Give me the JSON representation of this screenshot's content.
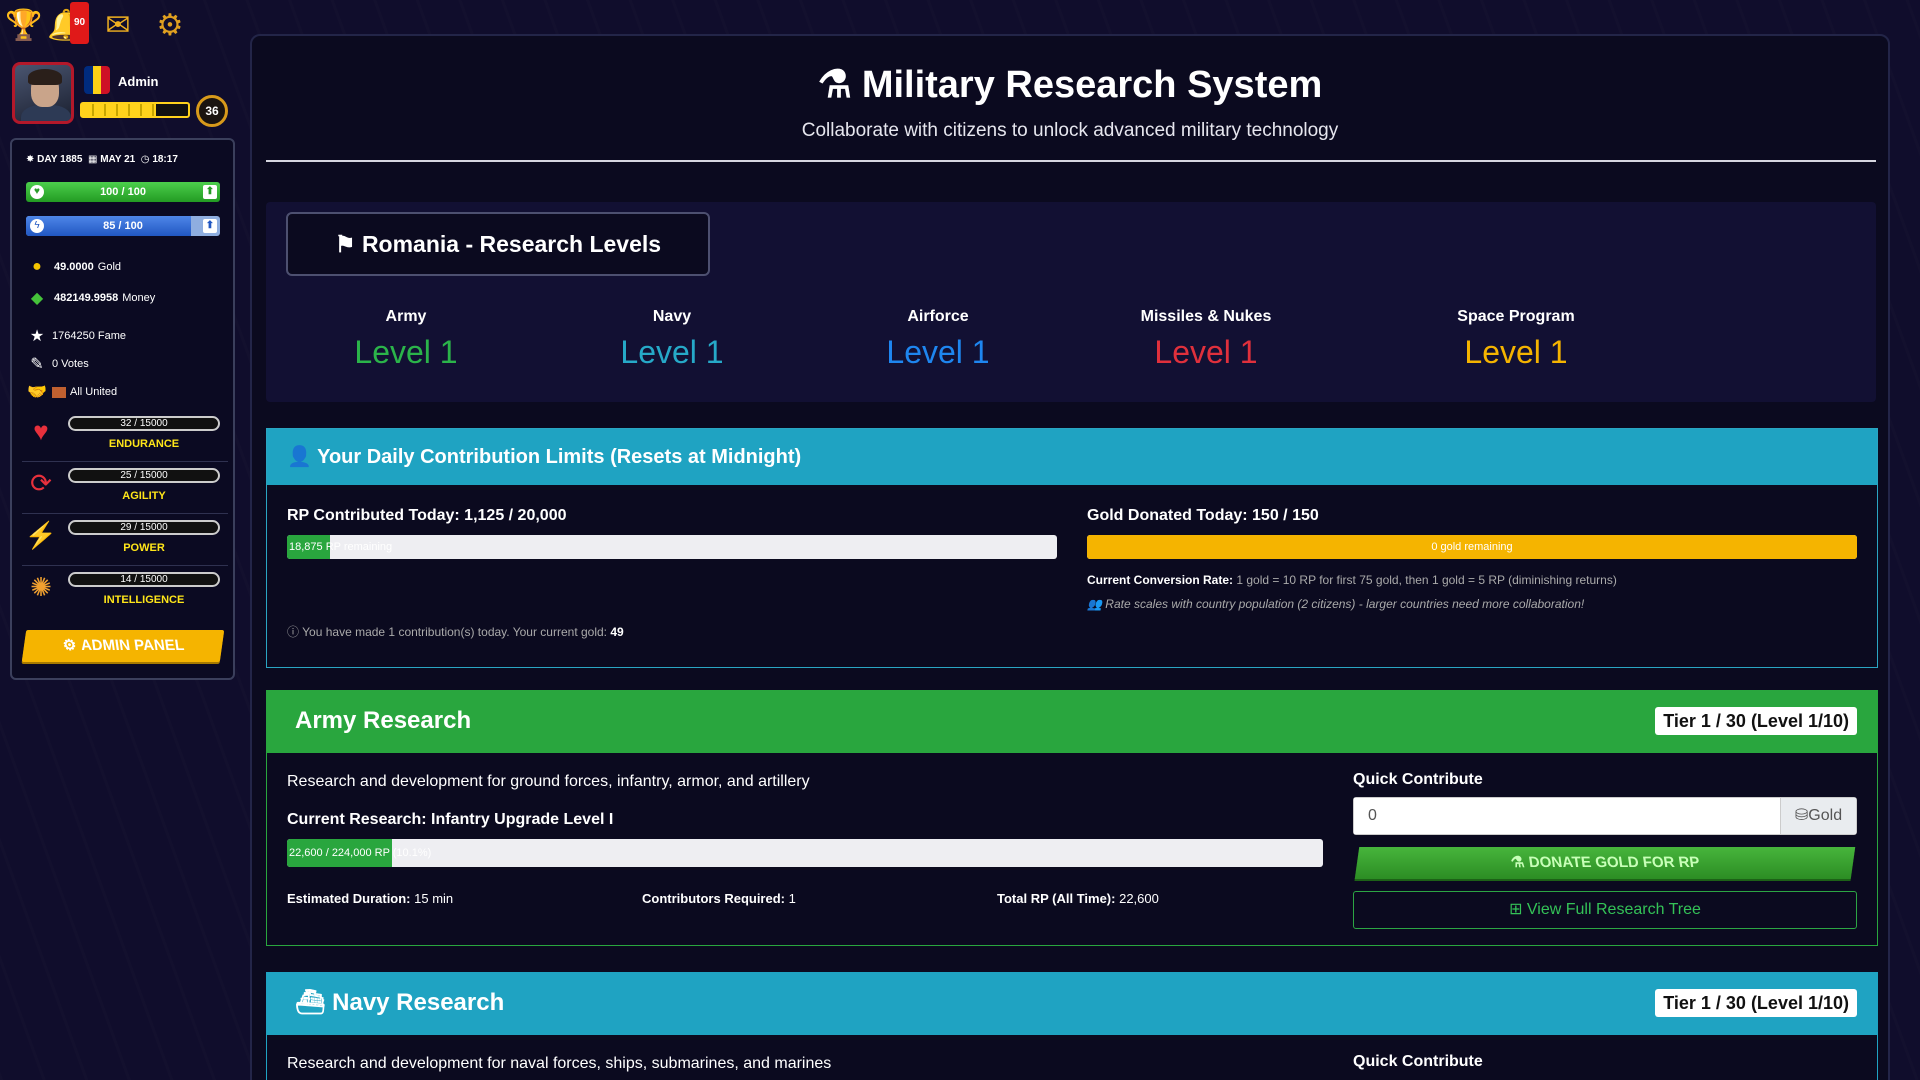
{
  "topbar": {
    "notifications_count": "90"
  },
  "profile": {
    "name": "Admin",
    "level": "36",
    "flag_colors": [
      "#002b7f",
      "#fcd116",
      "#ce1126"
    ]
  },
  "status": {
    "day_label": "DAY",
    "day": "1885",
    "date": "MAY 21",
    "time": "18:17",
    "health": "100 / 100",
    "health_ratio": 1.0,
    "energy": "85 / 100",
    "energy_ratio": 0.85
  },
  "resources": {
    "gold_value": "49.0000",
    "gold_unit": "Gold",
    "money_value": "482149.9958",
    "money_unit": "Money",
    "fame": "1764250 Fame",
    "votes": "0 Votes",
    "party": "All United"
  },
  "attributes": [
    {
      "value": "32 / 15000",
      "name": "ENDURANCE",
      "icon": "heart-icon"
    },
    {
      "value": "25 / 15000",
      "name": "AGILITY",
      "icon": "refresh-icon"
    },
    {
      "value": "29 / 15000",
      "name": "POWER",
      "icon": "bolt-icon"
    },
    {
      "value": "14 / 15000",
      "name": "INTELLIGENCE",
      "icon": "brain-icon"
    }
  ],
  "admin_button": "ADMIN PANEL",
  "page": {
    "title": "Military Research System",
    "subtitle": "Collaborate with citizens to unlock advanced military technology"
  },
  "country_box": "Romania - Research Levels",
  "levels": [
    {
      "name": "Army",
      "level": "Level 1",
      "color": "#2bb44a"
    },
    {
      "name": "Navy",
      "level": "Level 1",
      "color": "#26a9c8"
    },
    {
      "name": "Airforce",
      "level": "Level 1",
      "color": "#1e86f0"
    },
    {
      "name": "Missiles & Nukes",
      "level": "Level 1",
      "color": "#e0303c"
    },
    {
      "name": "Space Program",
      "level": "Level 1",
      "color": "#f5b400"
    }
  ],
  "limits": {
    "header": "Your Daily Contribution Limits (Resets at Midnight)",
    "rp_label": "RP Contributed Today: 1,125 / 20,000",
    "rp_bar_text": "18,875 RP remaining",
    "rp_ratio": 0.05625,
    "gold_label": "Gold Donated Today: 150 / 150",
    "gold_bar_text": "0 gold remaining",
    "gold_ratio": 1.0,
    "rate_label": "Current Conversion Rate:",
    "rate_text": "1 gold = 10 RP for first 75 gold, then 1 gold = 5 RP (diminishing returns)",
    "scale_text": "Rate scales with country population (2 citizens) - larger countries need more collaboration!",
    "contrib_text": "You have made 1 contribution(s) today. Your current gold:",
    "contrib_gold": "49"
  },
  "army": {
    "title": "Army Research",
    "tier": "Tier 1 / 30 (Level 1/10)",
    "desc": "Research and development for ground forces, infantry, armor, and artillery",
    "current": "Current Research: Infantry Upgrade Level I",
    "bar_text": "22,600 / 224,000 RP (10.1%)",
    "ratio": 0.101,
    "duration_label": "Estimated Duration:",
    "duration": "15 min",
    "contributors_label": "Contributors Required:",
    "contributors": "1",
    "total_label": "Total RP (All Time):",
    "total": "22,600",
    "quick_label": "Quick Contribute",
    "input_value": "0",
    "addon": "Gold",
    "donate": "DONATE GOLD FOR RP",
    "tree": "View Full Research Tree"
  },
  "navy": {
    "title": "Navy Research",
    "tier": "Tier 1 / 30 (Level 1/10)",
    "desc": "Research and development for naval forces, ships, submarines, and marines",
    "quick_label": "Quick Contribute"
  },
  "colors": {
    "army_green": "#29a63e",
    "navy_teal": "#1fa3c2",
    "gold": "#f5b400"
  }
}
